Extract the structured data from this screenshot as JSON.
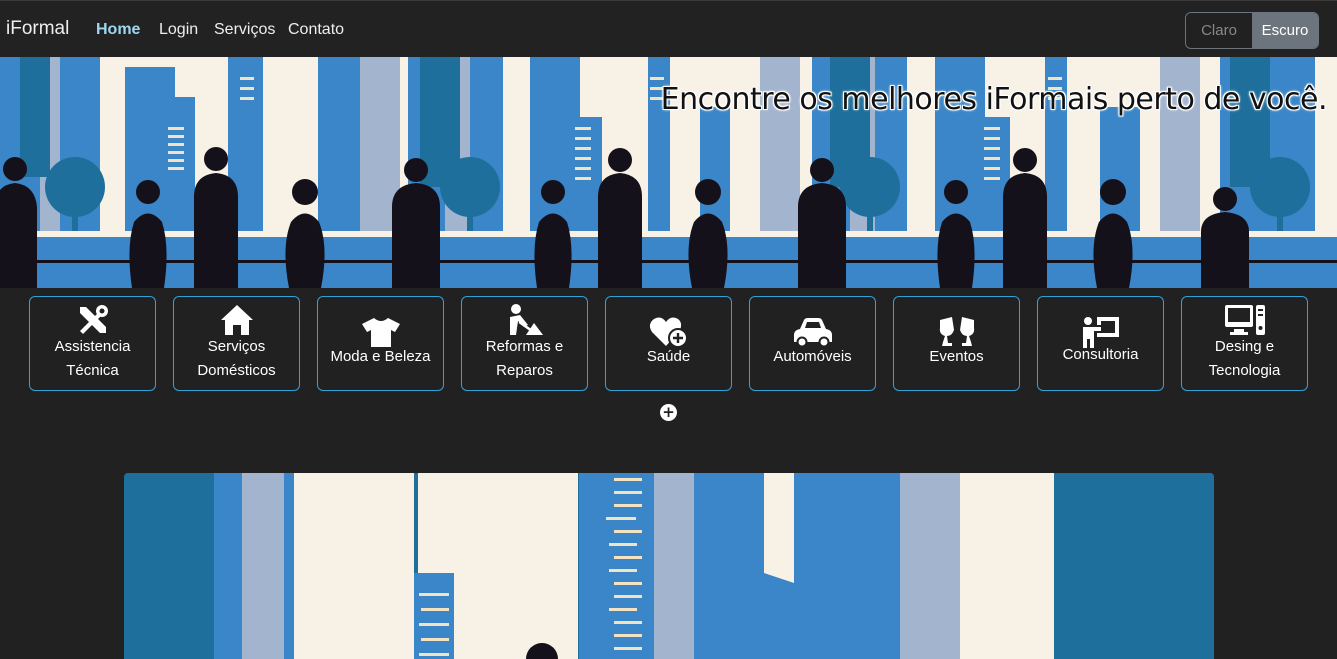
{
  "navbar": {
    "brand": "iFormal",
    "links": [
      {
        "label": "Home",
        "active": true
      },
      {
        "label": "Login",
        "active": false
      },
      {
        "label": "Serviços",
        "active": false
      },
      {
        "label": "Contato",
        "active": false
      }
    ],
    "theme": {
      "light_label": "Claro",
      "dark_label": "Escuro",
      "selected": "Escuro"
    }
  },
  "hero": {
    "title": "Encontre os melhores iFormais perto de você."
  },
  "categories": [
    {
      "label": "Assistencia Técnica",
      "icon": "tools-icon"
    },
    {
      "label": "Serviços Domésticos",
      "icon": "house-icon"
    },
    {
      "label": "Moda e Beleza",
      "icon": "shirt-icon"
    },
    {
      "label": "Reformas e Reparos",
      "icon": "person-digging-icon"
    },
    {
      "label": "Saúde",
      "icon": "heart-plus-icon"
    },
    {
      "label": "Automóveis",
      "icon": "car-icon"
    },
    {
      "label": "Eventos",
      "icon": "champagne-glasses-icon"
    },
    {
      "label": "Consultoria",
      "icon": "chalkboard-user-icon"
    },
    {
      "label": "Desing e Tecnologia",
      "icon": "computer-icon"
    }
  ],
  "colors": {
    "accent": "#2ea3d8",
    "background": "#212121",
    "navbar": "#222222",
    "active_link": "#9ed8f0",
    "city_blue": "#3a86c8",
    "city_dark_blue": "#1f6f9c",
    "silhouette": "#15111a"
  }
}
